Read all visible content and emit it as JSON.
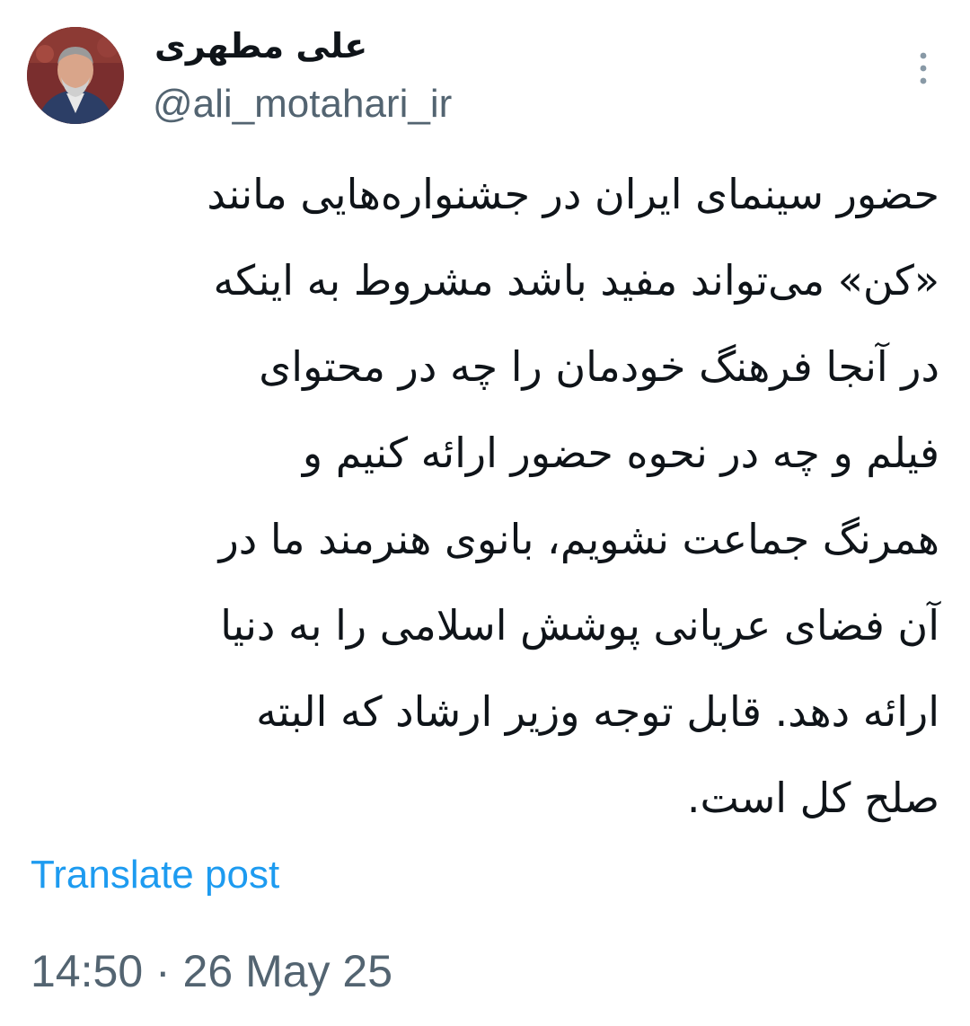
{
  "author": {
    "display_name": "علی مطهری",
    "handle": "@ali_motahari_ir"
  },
  "more_icon": "vertical-ellipsis",
  "tweet": {
    "lines": [
      "حضور سینمای ایران در جشنواره‌هایی مانند",
      "«کن» می‌تواند مفید باشد مشروط به اینکه",
      "در آنجا فرهنگ خودمان را چه در محتوای",
      "فیلم و چه در نحوه حضور ارائه کنیم و",
      "همرنگ جماعت نشویم، بانوی هنرمند ما در",
      "آن فضای عریانی پوشش اسلامی را به دنیا",
      "ارائه دهد. قابل توجه وزیر ارشاد که البته",
      "صلح کل است."
    ],
    "translate_label": "Translate post",
    "timestamp": "14:50 · 26 May 25"
  },
  "colors": {
    "text": "#0f1419",
    "secondary": "#536471",
    "link": "#1d9bf0"
  }
}
